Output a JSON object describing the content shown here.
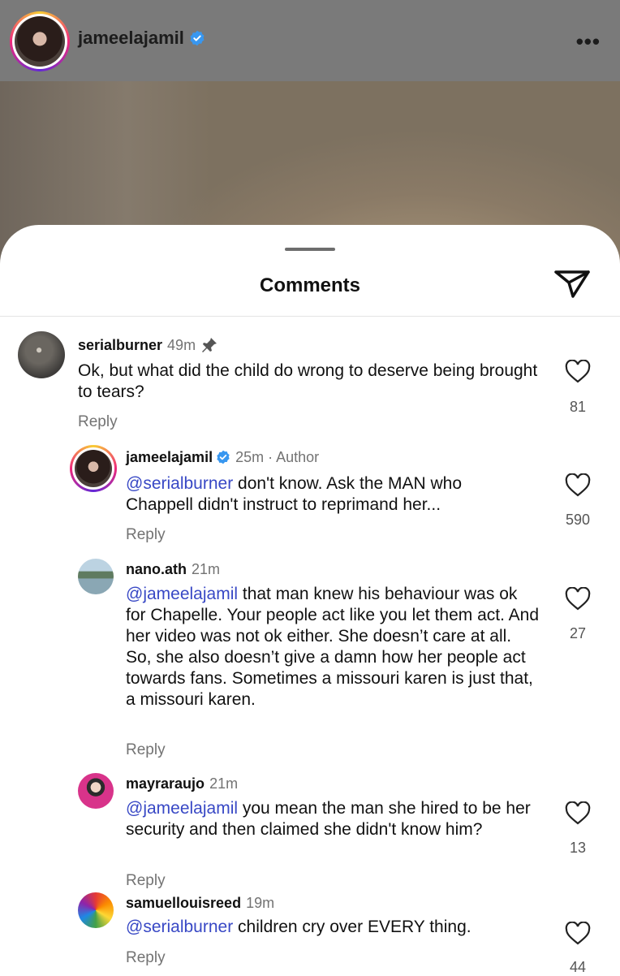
{
  "header": {
    "username": "jameelajamil",
    "more_icon": "more-horizontal-icon"
  },
  "sheet": {
    "title": "Comments",
    "share_icon": "paper-plane-icon"
  },
  "comments": [
    {
      "user": "serialburner",
      "meta": "49m",
      "pinned": true,
      "mention": "",
      "text": "Ok, but what did the child do wrong to deserve being brought to tears?",
      "reply": "Reply",
      "likes": "81"
    },
    {
      "user": "jameelajamil",
      "meta": "25m · Author",
      "verified": true,
      "mention": "@serialburner",
      "text": " don't know. Ask the MAN who Chappell didn't instruct to reprimand her...",
      "reply": "Reply",
      "likes": "590"
    },
    {
      "user": "nano.ath",
      "meta": "21m",
      "mention": "@jameelajamil",
      "text": " that man knew his behaviour was ok for Chapelle. Your people act like you let them act. And her video was not ok either. She doesn’t care at all. So, she also doesn’t give a damn how her people act towards fans. Sometimes a missouri karen is just that, a missouri karen.",
      "reply": "Reply",
      "likes": "27"
    },
    {
      "user": "mayraraujo",
      "meta": "21m",
      "mention": "@jameelajamil",
      "text": " you mean the man she hired to be her security and then claimed she didn't know him?",
      "reply": "Reply",
      "likes": "13"
    },
    {
      "user": "samuellouisreed",
      "meta": "19m",
      "mention": "@serialburner",
      "text": " children cry over EVERY thing.",
      "reply": "Reply",
      "likes": "44"
    }
  ],
  "colors": {
    "mention": "#3848c5",
    "meta": "#737373",
    "verified": "#3897f0"
  }
}
